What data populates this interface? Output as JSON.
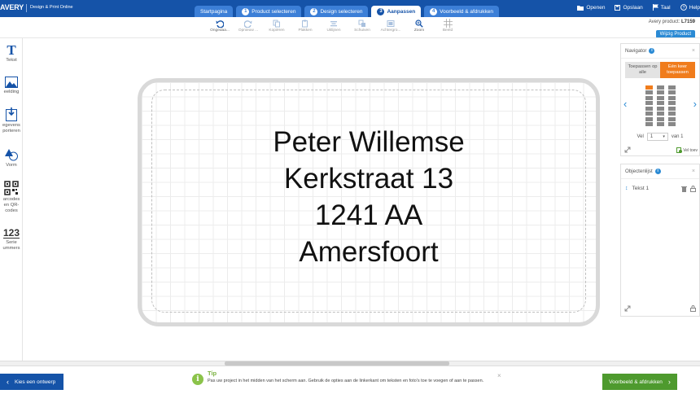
{
  "header": {
    "logo": "AVERY",
    "app_name": "Design & Print Online",
    "steps": [
      {
        "num": "",
        "label": "Startpagina"
      },
      {
        "num": "1",
        "label": "Product selecteren"
      },
      {
        "num": "2",
        "label": "Design selecteren"
      },
      {
        "num": "3",
        "label": "Aanpassen"
      },
      {
        "num": "4",
        "label": "Voorbeeld & afdrukken"
      }
    ],
    "active_step": 3,
    "links": {
      "open": "Openen",
      "save": "Opslaan",
      "language": "Taal",
      "help": "Help"
    }
  },
  "toolbar": {
    "undo": "Ongedaa...",
    "redo": "Opnieuw ...",
    "copy": "Kopiëren",
    "paste": "Plakken",
    "align": "Uitlijnen",
    "slide": "Schuiven",
    "background": "Achtergro...",
    "zoom": "Zoom",
    "view": "Beeld"
  },
  "product": {
    "label": "Avery product:",
    "code": "L7159",
    "change_button": "Wijzig Product"
  },
  "sidebar": {
    "text": "Tekst",
    "image": "eelding",
    "import_l1": "egevens",
    "import_l2": "porteren",
    "shape": "Vorm",
    "barcode_l1": "arcodes",
    "barcode_l2": "en QR-",
    "barcode_l3": "codes",
    "serial_icon": "123",
    "serial_l1": "Serie",
    "serial_l2": "ummers"
  },
  "label": {
    "lines": [
      "Peter Willemse",
      "Kerkstraat 13",
      "1241 AA",
      "Amersfoort"
    ]
  },
  "navigator": {
    "title": "Navigator",
    "apply_all": "Toepassen op alle",
    "apply_once": "Eén keer toepassen",
    "page_prefix": "Vel",
    "page_value": "1",
    "page_suffix": "van 1",
    "add_sheet": "Vel toev"
  },
  "objects": {
    "title": "Objectenlijst",
    "items": [
      "Tekst 1"
    ]
  },
  "bottom": {
    "back_button": "Kies een ontwerp",
    "tip_title": "Tip",
    "tip_text": "Pas uw project in het midden van het scherm aan. Gebruik de opties aan de linkerkant om teksten en foto's toe te voegen of aan te passen.",
    "next_button": "Voorbeeld & afdrukken"
  },
  "colors": {
    "header_blue": "#1553a8",
    "tab_blue": "#3c7fd7",
    "accent_orange": "#f07c1c",
    "next_green": "#4e9a2e",
    "info_blue": "#2a8ad4"
  },
  "icons": [
    "undo-icon",
    "redo-icon",
    "copy-icon",
    "paste-icon",
    "align-icon",
    "slide-icon",
    "background-icon",
    "zoom-icon",
    "view-icon",
    "text-icon",
    "image-icon",
    "import-icon",
    "shape-icon",
    "qr-icon",
    "serial-icon",
    "info-icon",
    "trash-icon",
    "lock-icon",
    "expand-icon"
  ]
}
